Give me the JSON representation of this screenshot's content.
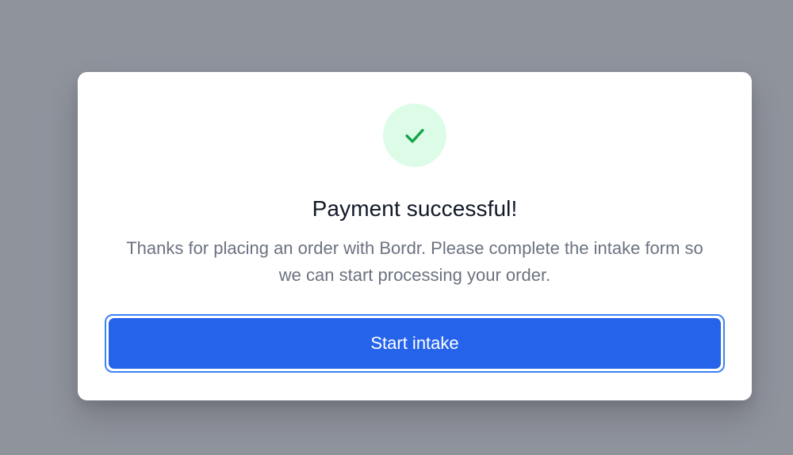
{
  "modal": {
    "icon": "check-icon",
    "icon_color": "#16a34a",
    "icon_bg": "#dcfce7",
    "title": "Payment successful!",
    "message": "Thanks for placing an order with Bordr. Please complete the intake form so we can start processing your order.",
    "button_label": "Start intake",
    "button_color": "#2563eb"
  },
  "theme": {
    "backdrop": "#8f939c",
    "title_color": "#111827",
    "message_color": "#6b7280"
  }
}
